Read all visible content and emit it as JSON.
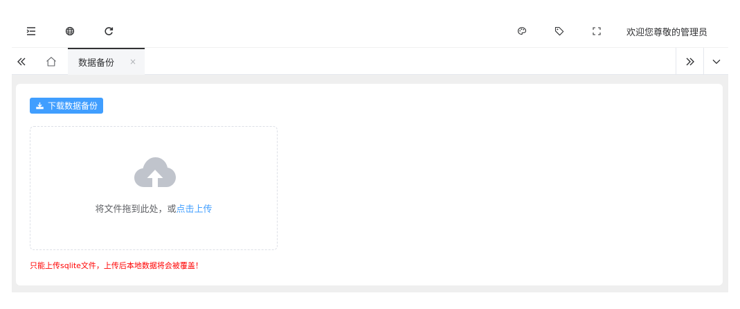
{
  "header": {
    "icons": [
      "menu-fold-icon",
      "globe-icon",
      "refresh-icon",
      "palette-icon",
      "tag-icon",
      "fullscreen-icon"
    ],
    "welcome_text": "欢迎您尊敬的管理员"
  },
  "tabs": {
    "items": [
      {
        "label": "数据备份",
        "active": true,
        "closable": true
      }
    ],
    "close_glyph": "×"
  },
  "main": {
    "download_button_label": "下载数据备份",
    "upload": {
      "text": "将文件拖到此处，或",
      "link": "点击上传"
    },
    "tip": "只能上传sqlite文件，上传后本地数据将会被覆盖！"
  },
  "colors": {
    "primary": "#409eff",
    "tip": "#ff0000",
    "content_bg": "#efefef",
    "tab_active_bg": "#f5f6f8",
    "cloud": "#c0c4cc"
  }
}
